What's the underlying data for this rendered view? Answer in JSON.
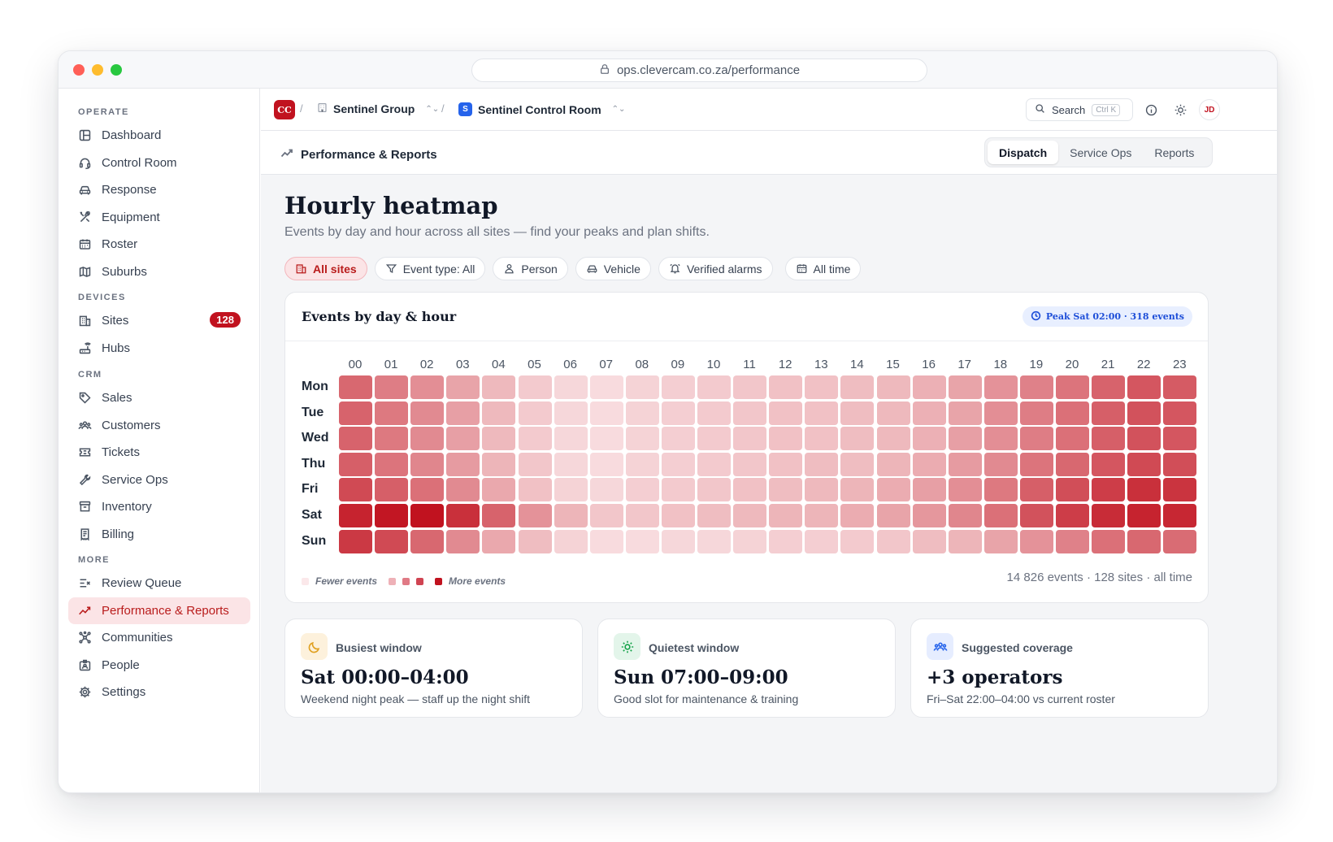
{
  "browser": {
    "url": "ops.clevercam.co.za/performance"
  },
  "sidebar": {
    "sections": [
      {
        "label": "OPERATE",
        "items": [
          {
            "label": "Dashboard",
            "icon": "dashboard-icon"
          },
          {
            "label": "Control Room",
            "icon": "headset-icon"
          },
          {
            "label": "Response",
            "icon": "car-icon"
          },
          {
            "label": "Equipment",
            "icon": "tools-icon"
          },
          {
            "label": "Roster",
            "icon": "calendar-icon"
          },
          {
            "label": "Suburbs",
            "icon": "map-icon"
          }
        ]
      },
      {
        "label": "DEVICES",
        "items": [
          {
            "label": "Sites",
            "icon": "building-icon",
            "badge": "128"
          },
          {
            "label": "Hubs",
            "icon": "router-icon"
          }
        ]
      },
      {
        "label": "CRM",
        "items": [
          {
            "label": "Sales",
            "icon": "tag-icon"
          },
          {
            "label": "Customers",
            "icon": "users-icon"
          },
          {
            "label": "Tickets",
            "icon": "ticket-icon"
          },
          {
            "label": "Service Ops",
            "icon": "wrench-icon"
          },
          {
            "label": "Inventory",
            "icon": "archive-icon"
          },
          {
            "label": "Billing",
            "icon": "receipt-icon"
          }
        ]
      },
      {
        "label": "MORE",
        "items": [
          {
            "label": "Review Queue",
            "icon": "review-icon"
          },
          {
            "label": "Performance & Reports",
            "icon": "trend-icon",
            "active": true
          },
          {
            "label": "Communities",
            "icon": "network-icon"
          },
          {
            "label": "People",
            "icon": "id-badge-icon"
          },
          {
            "label": "Settings",
            "icon": "gear-icon"
          }
        ]
      }
    ]
  },
  "topbar": {
    "org_logo": "CC",
    "group": "Sentinel Group",
    "room_logo": "S",
    "room": "Sentinel Control Room",
    "search_label": "Search",
    "search_shortcut": "Ctrl K",
    "avatar": "JD"
  },
  "subbar": {
    "page": "Performance & Reports",
    "tabs": [
      {
        "label": "Dispatch",
        "active": true
      },
      {
        "label": "Service Ops"
      },
      {
        "label": "Reports"
      }
    ]
  },
  "page": {
    "title": "Hourly heatmap",
    "subtitle": "Events by day and hour across all sites — find your peaks and plan shifts."
  },
  "filters": [
    {
      "label": "All sites",
      "icon": "building-icon",
      "active": true
    },
    {
      "label": "Event type: All",
      "icon": "filter-icon"
    },
    {
      "label": "Person",
      "icon": "person-icon"
    },
    {
      "label": "Vehicle",
      "icon": "car-icon"
    },
    {
      "label": "Verified alarms",
      "icon": "alarm-icon"
    },
    {
      "label": "All time",
      "icon": "calendar-icon"
    }
  ],
  "heatmap_card": {
    "title": "Events by day & hour",
    "peak": "Peak Sat 02:00 · 318 events",
    "legend_low": "Fewer events",
    "legend_high": "More events",
    "footer": "14 826 events · 128 sites · all time"
  },
  "colors": {
    "accent": "#c1121f",
    "heat_low": "#fbe8ea",
    "heat_high": "#c1121f"
  },
  "chart_data": {
    "type": "heatmap",
    "x": [
      "00",
      "01",
      "02",
      "03",
      "04",
      "05",
      "06",
      "07",
      "08",
      "09",
      "10",
      "11",
      "12",
      "13",
      "14",
      "15",
      "16",
      "17",
      "18",
      "19",
      "20",
      "21",
      "22",
      "23"
    ],
    "y": [
      "Mon",
      "Tue",
      "Wed",
      "Thu",
      "Fri",
      "Sat",
      "Sun"
    ],
    "intensity_scale": [
      0,
      1
    ],
    "values": [
      [
        0.6,
        0.5,
        0.42,
        0.32,
        0.22,
        0.14,
        0.08,
        0.06,
        0.1,
        0.12,
        0.14,
        0.16,
        0.18,
        0.18,
        0.2,
        0.22,
        0.26,
        0.32,
        0.4,
        0.48,
        0.54,
        0.62,
        0.68,
        0.66
      ],
      [
        0.62,
        0.52,
        0.44,
        0.34,
        0.22,
        0.14,
        0.08,
        0.06,
        0.1,
        0.12,
        0.14,
        0.16,
        0.18,
        0.18,
        0.2,
        0.22,
        0.26,
        0.32,
        0.42,
        0.5,
        0.56,
        0.64,
        0.7,
        0.68
      ],
      [
        0.62,
        0.52,
        0.44,
        0.34,
        0.22,
        0.14,
        0.08,
        0.06,
        0.1,
        0.12,
        0.14,
        0.16,
        0.18,
        0.18,
        0.2,
        0.22,
        0.26,
        0.34,
        0.42,
        0.5,
        0.56,
        0.64,
        0.7,
        0.68
      ],
      [
        0.64,
        0.54,
        0.46,
        0.36,
        0.24,
        0.16,
        0.08,
        0.06,
        0.1,
        0.12,
        0.14,
        0.16,
        0.18,
        0.2,
        0.2,
        0.24,
        0.28,
        0.36,
        0.44,
        0.54,
        0.6,
        0.68,
        0.74,
        0.72
      ],
      [
        0.74,
        0.64,
        0.56,
        0.44,
        0.3,
        0.18,
        0.1,
        0.08,
        0.12,
        0.14,
        0.16,
        0.18,
        0.2,
        0.22,
        0.24,
        0.28,
        0.34,
        0.42,
        0.52,
        0.64,
        0.72,
        0.8,
        0.86,
        0.84
      ],
      [
        0.92,
        0.98,
        1.0,
        0.86,
        0.62,
        0.4,
        0.24,
        0.16,
        0.16,
        0.18,
        0.2,
        0.22,
        0.24,
        0.24,
        0.28,
        0.32,
        0.38,
        0.46,
        0.56,
        0.7,
        0.8,
        0.88,
        0.92,
        0.9
      ],
      [
        0.82,
        0.74,
        0.6,
        0.44,
        0.3,
        0.2,
        0.1,
        0.06,
        0.06,
        0.08,
        0.08,
        0.1,
        0.12,
        0.12,
        0.14,
        0.16,
        0.2,
        0.24,
        0.32,
        0.4,
        0.48,
        0.56,
        0.6,
        0.58
      ]
    ],
    "legend_placement": "bottom-left"
  },
  "stats": [
    {
      "icon": "moon-icon",
      "label": "Busiest window",
      "value": "Sat 00:00–04:00",
      "note": "Weekend night peak — staff up the night shift"
    },
    {
      "icon": "sun-icon",
      "label": "Quietest window",
      "value": "Sun 07:00–09:00",
      "note": "Good slot for maintenance & training"
    },
    {
      "icon": "users-icon",
      "label": "Suggested coverage",
      "value": "+3 operators",
      "note": "Fri–Sat 22:00–04:00 vs current roster"
    }
  ]
}
